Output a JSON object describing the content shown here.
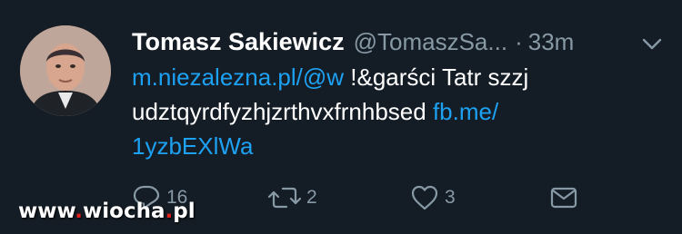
{
  "tweet": {
    "author_name": "Tomasz Sakiewicz",
    "handle": "@TomaszSa...",
    "separator": "·",
    "time": "33m",
    "text": {
      "line1_link": "m.niezalezna.pl/@w",
      "line1_text": " !&garści Tatr szzj",
      "line2_text": "udztqyrdfyzhjzrthvxfrnhbsed ",
      "line2_link": "fb.me/",
      "line3_link": "1yzbEXlWa"
    },
    "actions": {
      "reply_icon": "reply-icon",
      "reply_count": "16",
      "retweet_icon": "retweet-icon",
      "retweet_count": "2",
      "like_icon": "heart-icon",
      "like_count": "3",
      "message_icon": "envelope-icon"
    },
    "menu_icon": "chevron-down-icon"
  },
  "watermark": {
    "part1": "www",
    "part2": ".",
    "part3": "wiocha",
    "part4": ".",
    "part5": "pl"
  },
  "colors": {
    "background": "#141d26",
    "link": "#1da1f2",
    "muted": "#8899a6",
    "text": "#ffffff"
  }
}
